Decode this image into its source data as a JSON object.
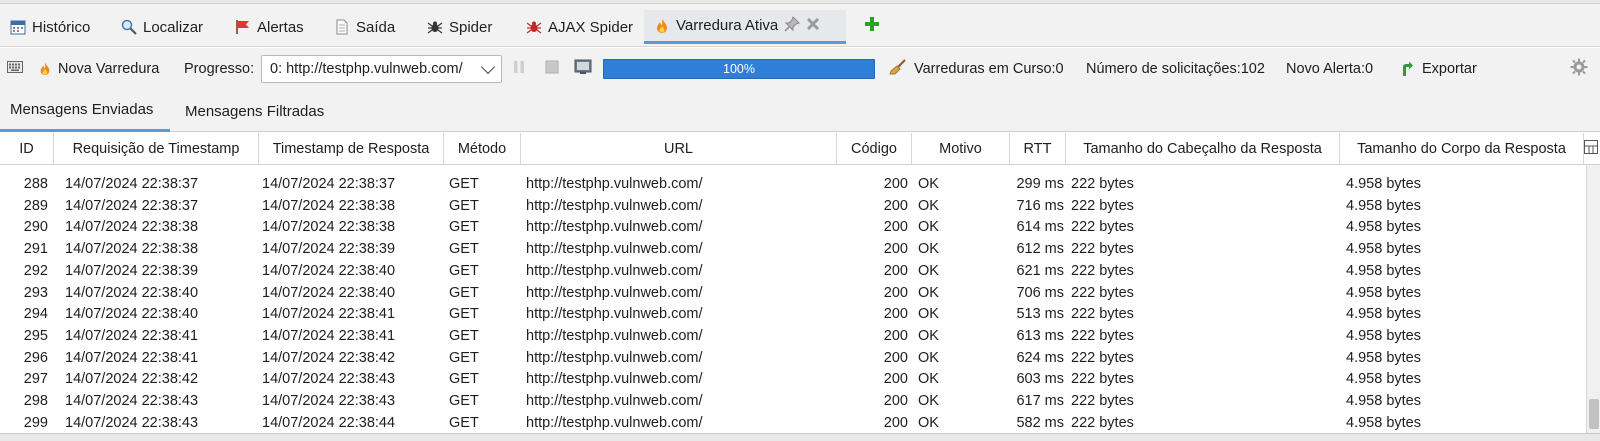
{
  "tabs": [
    {
      "label": "Histórico",
      "icon": "calendar-icon"
    },
    {
      "label": "Localizar",
      "icon": "search-icon"
    },
    {
      "label": "Alertas",
      "icon": "flag-icon"
    },
    {
      "label": "Saída",
      "icon": "document-icon"
    },
    {
      "label": "Spider",
      "icon": "spider-icon"
    },
    {
      "label": "AJAX Spider",
      "icon": "red-spider-icon"
    },
    {
      "label": "Varredura Ativa",
      "icon": "flame-icon",
      "active": true
    }
  ],
  "toolbar": {
    "new_scan_label": "Nova Varredura",
    "progress_label": "Progresso:",
    "progress_select": "0: http://testphp.vulnweb.com/",
    "progress_percent": "100%",
    "progress_value": 1.0,
    "scans_in_progress": "Varreduras em Curso:0",
    "requests_count": "Número de solicitações:102",
    "new_alerts": "Novo Alerta:0",
    "export_label": "Exportar"
  },
  "subtabs": [
    {
      "label": "Mensagens Enviadas",
      "active": true
    },
    {
      "label": "Mensagens Filtradas",
      "active": false
    }
  ],
  "columns": [
    "ID",
    "Requisição de Timestamp",
    "Timestamp de Resposta",
    "Método",
    "URL",
    "Código",
    "Motivo",
    "RTT",
    "Tamanho do Cabeçalho da Resposta",
    "Tamanho do Corpo da Resposta"
  ],
  "rows": [
    {
      "id": "288",
      "req": "14/07/2024 22:38:37",
      "resp": "14/07/2024 22:38:37",
      "method": "GET",
      "url": "http://testphp.vulnweb.com/",
      "code": "200",
      "reason": "OK",
      "rtt": "299 ms",
      "header": "222 bytes",
      "body": "4.958 bytes"
    },
    {
      "id": "289",
      "req": "14/07/2024 22:38:37",
      "resp": "14/07/2024 22:38:38",
      "method": "GET",
      "url": "http://testphp.vulnweb.com/",
      "code": "200",
      "reason": "OK",
      "rtt": "716 ms",
      "header": "222 bytes",
      "body": "4.958 bytes"
    },
    {
      "id": "290",
      "req": "14/07/2024 22:38:38",
      "resp": "14/07/2024 22:38:38",
      "method": "GET",
      "url": "http://testphp.vulnweb.com/",
      "code": "200",
      "reason": "OK",
      "rtt": "614 ms",
      "header": "222 bytes",
      "body": "4.958 bytes"
    },
    {
      "id": "291",
      "req": "14/07/2024 22:38:38",
      "resp": "14/07/2024 22:38:39",
      "method": "GET",
      "url": "http://testphp.vulnweb.com/",
      "code": "200",
      "reason": "OK",
      "rtt": "612 ms",
      "header": "222 bytes",
      "body": "4.958 bytes"
    },
    {
      "id": "292",
      "req": "14/07/2024 22:38:39",
      "resp": "14/07/2024 22:38:40",
      "method": "GET",
      "url": "http://testphp.vulnweb.com/",
      "code": "200",
      "reason": "OK",
      "rtt": "621 ms",
      "header": "222 bytes",
      "body": "4.958 bytes"
    },
    {
      "id": "293",
      "req": "14/07/2024 22:38:40",
      "resp": "14/07/2024 22:38:40",
      "method": "GET",
      "url": "http://testphp.vulnweb.com/",
      "code": "200",
      "reason": "OK",
      "rtt": "706 ms",
      "header": "222 bytes",
      "body": "4.958 bytes"
    },
    {
      "id": "294",
      "req": "14/07/2024 22:38:40",
      "resp": "14/07/2024 22:38:41",
      "method": "GET",
      "url": "http://testphp.vulnweb.com/",
      "code": "200",
      "reason": "OK",
      "rtt": "513 ms",
      "header": "222 bytes",
      "body": "4.958 bytes"
    },
    {
      "id": "295",
      "req": "14/07/2024 22:38:41",
      "resp": "14/07/2024 22:38:41",
      "method": "GET",
      "url": "http://testphp.vulnweb.com/",
      "code": "200",
      "reason": "OK",
      "rtt": "613 ms",
      "header": "222 bytes",
      "body": "4.958 bytes"
    },
    {
      "id": "296",
      "req": "14/07/2024 22:38:41",
      "resp": "14/07/2024 22:38:42",
      "method": "GET",
      "url": "http://testphp.vulnweb.com/",
      "code": "200",
      "reason": "OK",
      "rtt": "624 ms",
      "header": "222 bytes",
      "body": "4.958 bytes"
    },
    {
      "id": "297",
      "req": "14/07/2024 22:38:42",
      "resp": "14/07/2024 22:38:43",
      "method": "GET",
      "url": "http://testphp.vulnweb.com/",
      "code": "200",
      "reason": "OK",
      "rtt": "603 ms",
      "header": "222 bytes",
      "body": "4.958 bytes"
    },
    {
      "id": "298",
      "req": "14/07/2024 22:38:43",
      "resp": "14/07/2024 22:38:43",
      "method": "GET",
      "url": "http://testphp.vulnweb.com/",
      "code": "200",
      "reason": "OK",
      "rtt": "617 ms",
      "header": "222 bytes",
      "body": "4.958 bytes"
    },
    {
      "id": "299",
      "req": "14/07/2024 22:38:43",
      "resp": "14/07/2024 22:38:44",
      "method": "GET",
      "url": "http://testphp.vulnweb.com/",
      "code": "200",
      "reason": "OK",
      "rtt": "582 ms",
      "header": "222 bytes",
      "body": "4.958 bytes"
    }
  ],
  "colors": {
    "accent": "#5b9bd5",
    "progress_fill": "#2f7fd8",
    "add_tab": "#27a327",
    "export_arrow": "#2e9b3a"
  }
}
